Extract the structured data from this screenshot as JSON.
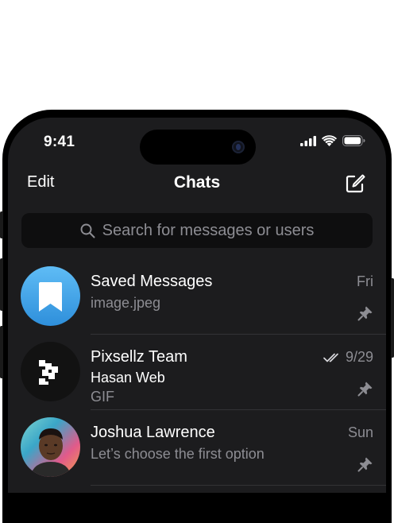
{
  "status_bar": {
    "time": "9:41",
    "icons": [
      "signal-icon",
      "wifi-icon",
      "battery-icon"
    ]
  },
  "header": {
    "edit_label": "Edit",
    "title": "Chats",
    "compose_icon": "compose-icon"
  },
  "search": {
    "placeholder": "Search for messages or users",
    "icon": "search-icon"
  },
  "chats": [
    {
      "name": "Saved Messages",
      "preview": "image.jpeg",
      "time": "Fri",
      "pinned": true,
      "avatar": "bookmark-icon"
    },
    {
      "name": "Pixsellz Team",
      "sender": "Hasan Web",
      "preview": "GIF",
      "time": "9/29",
      "read": true,
      "pinned": true,
      "avatar": "pixsellz-logo"
    },
    {
      "name": "Joshua Lawrence",
      "preview": "Let’s choose the first option",
      "time": "Sun",
      "pinned": true,
      "avatar": "user-photo"
    }
  ],
  "colors": {
    "background": "#1c1c1e",
    "secondary_text": "#8d8d93",
    "saved_avatar": "#3e9fe6"
  }
}
